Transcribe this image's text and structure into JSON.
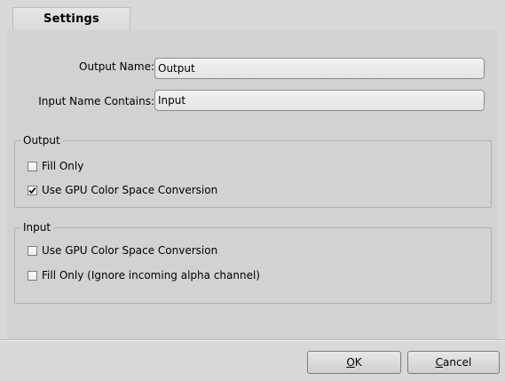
{
  "tabs": [
    {
      "label": "Settings",
      "active": true
    }
  ],
  "fields": {
    "output_name": {
      "label": "Output Name:",
      "value": "Output"
    },
    "input_name_contains": {
      "label": "Input Name Contains:",
      "value": "Input"
    }
  },
  "groups": {
    "output": {
      "title": "Output",
      "options": [
        {
          "label": "Fill Only",
          "checked": false
        },
        {
          "label": "Use GPU Color Space Conversion",
          "checked": true
        }
      ]
    },
    "input": {
      "title": "Input",
      "options": [
        {
          "label": "Use GPU Color Space Conversion",
          "checked": false
        },
        {
          "label": "Fill Only (Ignore incoming alpha channel)",
          "checked": false
        }
      ]
    }
  },
  "buttons": {
    "ok": {
      "accel": "O",
      "rest": "K"
    },
    "cancel": {
      "accel": "C",
      "rest": "ancel"
    }
  },
  "colors": {
    "background": "#d8d8d8",
    "panel": "#d2d2d2",
    "checkmark": "#000000"
  },
  "icons": {
    "checked": "check-icon"
  }
}
